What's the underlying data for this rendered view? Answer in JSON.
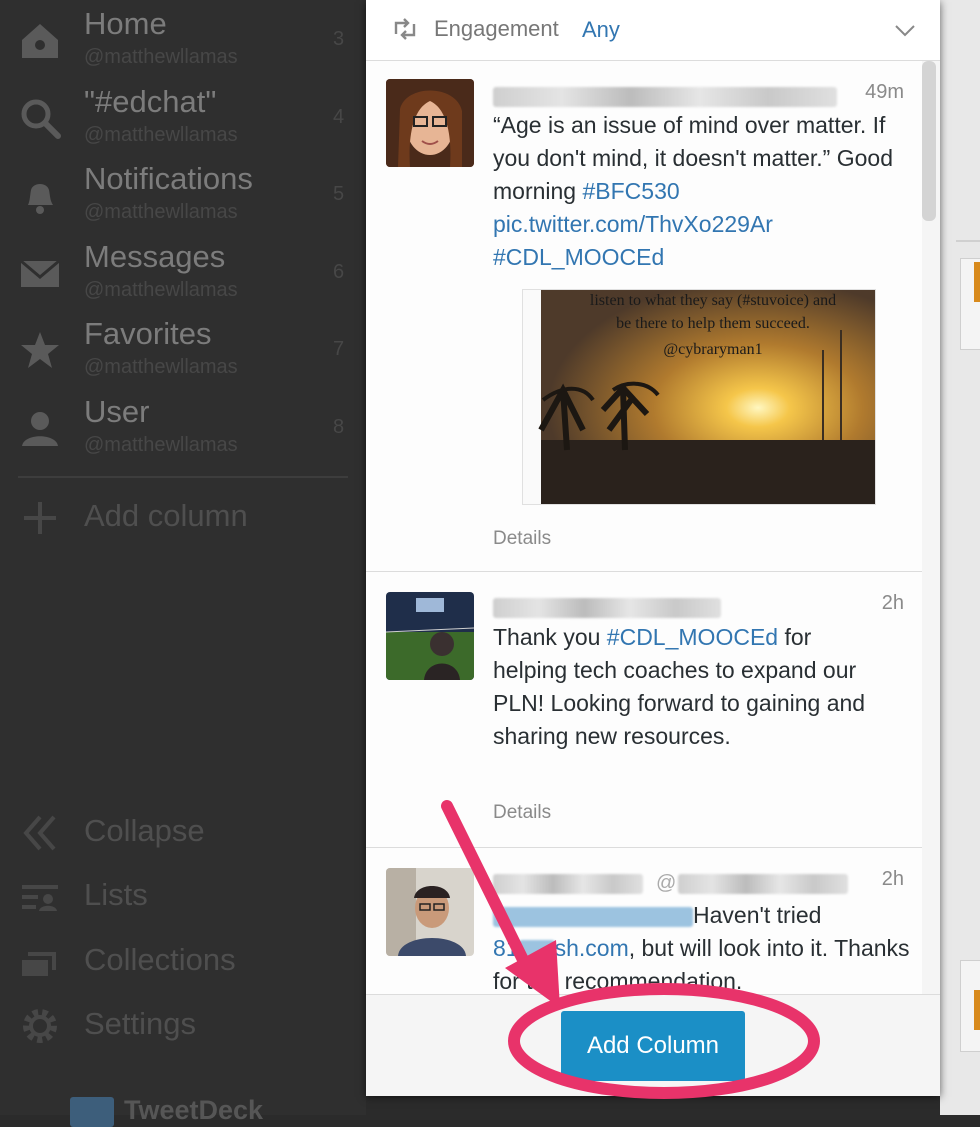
{
  "sidebar": {
    "nav": [
      {
        "label": "Home",
        "handle": "@matthewllamas",
        "num": "3",
        "icon": "home-icon"
      },
      {
        "label": "\"#edchat\"",
        "handle": "@matthewllamas",
        "num": "4",
        "icon": "search-icon"
      },
      {
        "label": "Notifications",
        "handle": "@matthewllamas",
        "num": "5",
        "icon": "bell-icon"
      },
      {
        "label": "Messages",
        "handle": "@matthewllamas",
        "num": "6",
        "icon": "envelope-icon"
      },
      {
        "label": "Favorites",
        "handle": "@matthewllamas",
        "num": "7",
        "icon": "star-icon"
      },
      {
        "label": "User",
        "handle": "@matthewllamas",
        "num": "8",
        "icon": "user-icon"
      }
    ],
    "add_column": "Add column",
    "collapse": "Collapse",
    "lists": "Lists",
    "collections": "Collections",
    "settings": "Settings",
    "brand": "TweetDeck"
  },
  "filter": {
    "label": "Engagement",
    "value": "Any"
  },
  "tweets": [
    {
      "time": "49m",
      "text_parts": [
        "“Age is an issue of mind over matter. If you don't mind, it doesn't matter.” Good morning ",
        "#BFC530",
        " pic.twitter.com/ThvXo229Ar ",
        "#CDL_MOOCEd"
      ],
      "image_caption": [
        "listen to what they say (#stuvoice) and",
        "be there to help them succeed.",
        "@cybraryman1"
      ],
      "details": "Details"
    },
    {
      "time": "2h",
      "text_parts": [
        "Thank you ",
        "#CDL_MOOCEd",
        " for helping tech coaches to expand our PLN!  Looking forward to gaining and sharing new resources."
      ],
      "details": "Details"
    },
    {
      "time": "2h",
      "author_visible": "@",
      "text_parts": [
        "Haven't tried",
        "81",
        "sh.com",
        ", but will look into it. Tha",
        "nks for the recommendation."
      ]
    }
  ],
  "button": {
    "label": "Add Column"
  },
  "colors": {
    "accent": "#1b8fc6",
    "link": "#3276b1",
    "annotation": "#e8336a"
  }
}
